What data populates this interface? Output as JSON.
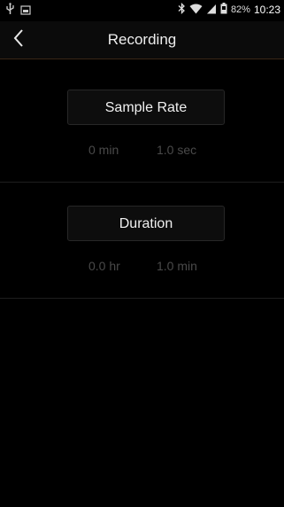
{
  "status_bar": {
    "battery_percent": "82%",
    "time": "10:23",
    "icons": [
      "usb-icon",
      "screenshot-icon",
      "bluetooth-icon",
      "wifi-icon",
      "cell-signal-icon",
      "battery-icon"
    ]
  },
  "header": {
    "title": "Recording",
    "back_icon": "chevron-left-icon"
  },
  "sample_rate": {
    "button_label": "Sample Rate",
    "left_value": "0 min",
    "right_value": "1.0 sec"
  },
  "duration": {
    "button_label": "Duration",
    "left_value": "0.0 hr",
    "right_value": "1.0 min"
  }
}
